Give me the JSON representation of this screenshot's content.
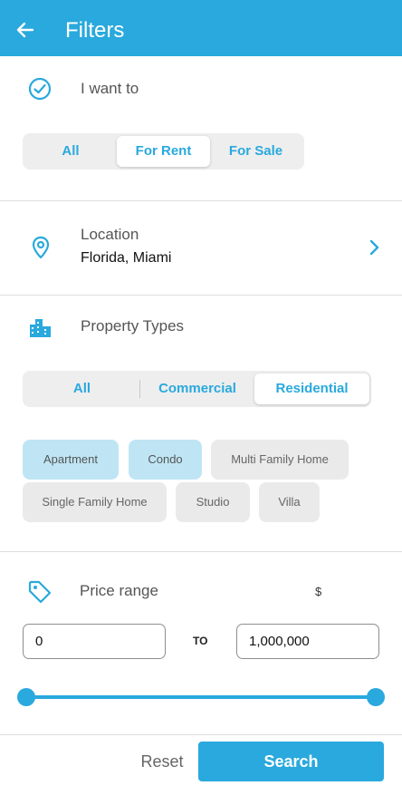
{
  "header": {
    "title": "Filters",
    "back_icon": "arrow-left-icon"
  },
  "intent": {
    "label": "I want to",
    "icon": "check-circle-icon",
    "options": [
      "All",
      "For Rent",
      "For Sale"
    ],
    "selected": "For Rent"
  },
  "location": {
    "label": "Location",
    "value": "Florida, Miami",
    "icon": "map-pin-icon"
  },
  "property_types": {
    "label": "Property Types",
    "icon": "buildings-icon",
    "categories": [
      "All",
      "Commercial",
      "Residential"
    ],
    "selected_category": "Residential",
    "chips": [
      {
        "label": "Apartment",
        "selected": true
      },
      {
        "label": "Condo",
        "selected": true
      },
      {
        "label": "Multi Family Home",
        "selected": false
      },
      {
        "label": "Single Family Home",
        "selected": false
      },
      {
        "label": "Studio",
        "selected": false
      },
      {
        "label": "Villa",
        "selected": false
      }
    ]
  },
  "price": {
    "label": "Price range",
    "icon": "tag-icon",
    "currency": "$",
    "min": "0",
    "to_label": "TO",
    "max": "1,000,000",
    "slider_min_fraction": 0,
    "slider_max_fraction": 1
  },
  "footer": {
    "reset_label": "Reset",
    "search_label": "Search"
  },
  "colors": {
    "accent": "#29a9dd",
    "chip_selected": "#bfe5f5",
    "chip": "#eaeaea"
  }
}
